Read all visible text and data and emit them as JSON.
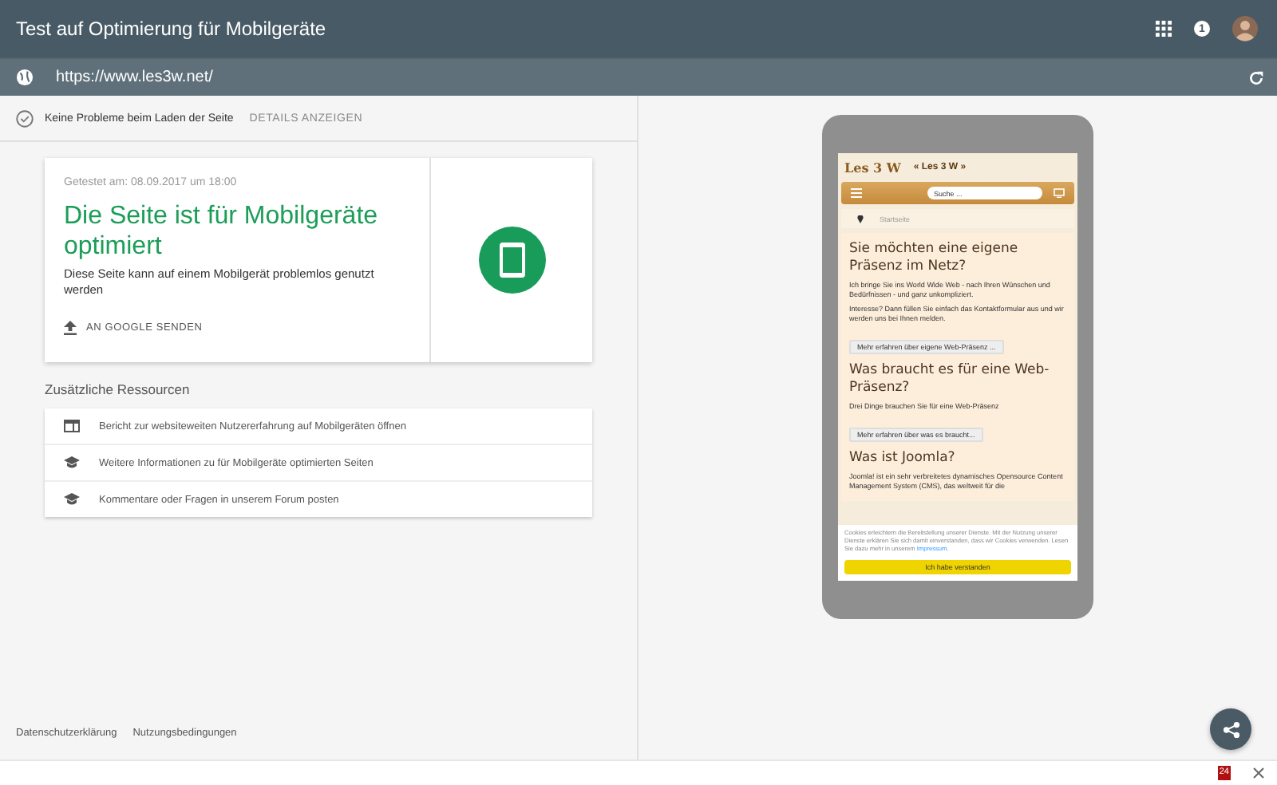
{
  "header": {
    "title": "Test auf Optimierung für Mobilgeräte",
    "notification_count": "1"
  },
  "url_bar": {
    "value": "https://www.les3w.net/"
  },
  "status": {
    "text": "Keine Probleme beim Laden der Seite",
    "action": "DETAILS ANZEIGEN"
  },
  "result_card": {
    "tested": "Getestet am: 08.09.2017 um 18:00",
    "headline": "Die Seite ist für Mobilgeräte optimiert",
    "description": "Diese Seite kann auf einem Mobilgerät problemlos genutzt werden",
    "submit": "AN GOOGLE SENDEN",
    "passed": true
  },
  "resources": {
    "title": "Zusätzliche Ressourcen",
    "items": [
      {
        "kind": "report",
        "label": "Bericht zur websiteweiten Nutzererfahrung auf Mobilgeräten öffnen"
      },
      {
        "kind": "learn",
        "label": "Weitere Informationen zu für Mobilgeräte optimierten Seiten"
      },
      {
        "kind": "learn",
        "label": "Kommentare oder Fragen in unserem Forum posten"
      }
    ]
  },
  "footer_links": [
    "Datenschutzerklärung",
    "Nutzungsbedingungen"
  ],
  "preview": {
    "logo": "Les 3 W",
    "brand": "« Les 3 W »",
    "search_placeholder": "Suche ...",
    "breadcrumb": "Startseite",
    "sections": [
      {
        "heading": "Sie möchten eine eigene Präsenz im Netz?",
        "paragraphs": [
          "Ich bringe Sie ins World Wide Web - nach Ihren Wünschen und Bedürfnissen - und ganz unkompliziert.",
          "Interesse? Dann füllen Sie einfach das Kontaktformular aus und wir werden uns bei Ihnen melden."
        ],
        "button": "Mehr erfahren über eigene Web-Präsenz ..."
      },
      {
        "heading": "Was braucht es für eine Web-Präsenz?",
        "paragraphs": [
          "Drei Dinge brauchen Sie für eine Web-Präsenz"
        ],
        "button": "Mehr erfahren über was es braucht..."
      },
      {
        "heading": "Was ist Joomla?",
        "paragraphs": [
          "Joomla! ist ein sehr verbreitetes dynamisches Opensource Content Management System (CMS), das weltweit für die"
        ]
      }
    ],
    "cookie_text": "Cookies erleichtern die Bereitstellung unserer Dienste. Mit der Nutzung unserer Dienste erklären Sie sich damit einverstanden, dass wir Cookies verwenden. Lesen Sie dazu mehr in unserem",
    "cookie_link": "Impressum.",
    "cookie_button": "Ich habe verstanden"
  },
  "bottom_bar": {
    "badge": "24"
  }
}
